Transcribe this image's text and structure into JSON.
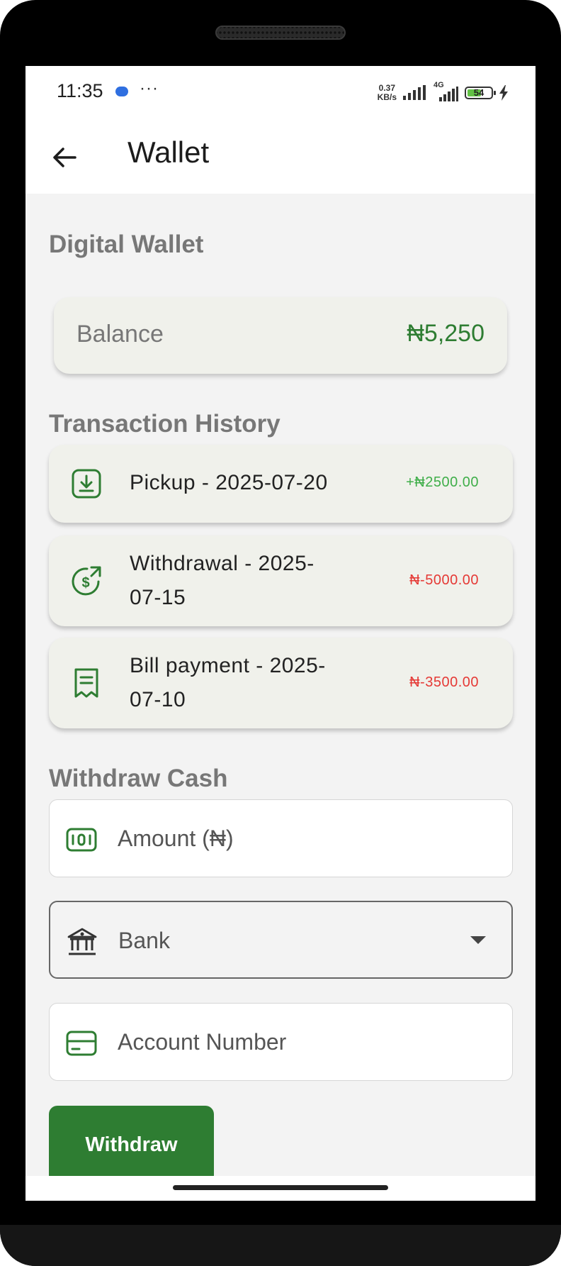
{
  "status_bar": {
    "time": "11:35",
    "more": "···",
    "net_speed_value": "0.37",
    "net_speed_unit": "KB/s",
    "network_type": "4G",
    "battery_level": "54"
  },
  "app_bar": {
    "title": "Wallet"
  },
  "wallet": {
    "heading": "Digital Wallet",
    "balance_label": "Balance",
    "balance_value": "₦5,250"
  },
  "transactions": {
    "heading": "Transaction History",
    "items": [
      {
        "title": "Pickup - 2025-07-20",
        "amount": "+₦2500.00",
        "icon": "download-icon"
      },
      {
        "title": "Withdrawal - 2025-07-15",
        "amount": "₦-5000.00",
        "icon": "dollar-send-icon"
      },
      {
        "title": "Bill payment - 2025-07-10",
        "amount": "₦-3500.00",
        "icon": "receipt-icon"
      }
    ]
  },
  "withdraw": {
    "heading": "Withdraw Cash",
    "amount_placeholder": "Amount (₦)",
    "bank_label": "Bank",
    "account_placeholder": "Account Number",
    "button_label": "Withdraw"
  },
  "colors": {
    "primary": "#2e7d32",
    "positive": "#3fae49",
    "negative": "#e53935",
    "card": "#f0f1eb"
  }
}
